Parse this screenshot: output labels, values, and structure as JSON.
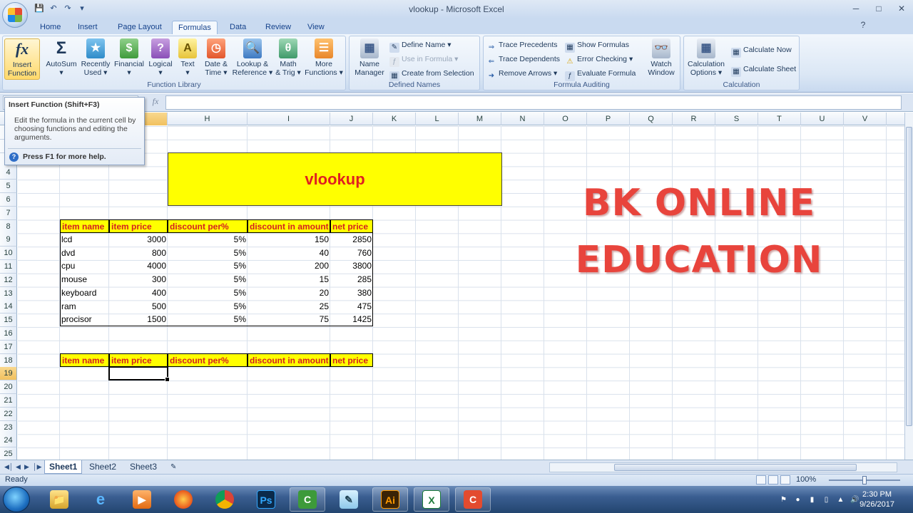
{
  "window": {
    "title": "vlookup - Microsoft Excel",
    "minimize_glyph": "─",
    "maximize_glyph": "□",
    "close_glyph": "✕"
  },
  "tabs": [
    "Home",
    "Insert",
    "Page Layout",
    "Formulas",
    "Data",
    "Review",
    "View"
  ],
  "ribbon": {
    "function_library": {
      "label": "Function Library",
      "buttons": [
        {
          "line1": "Insert",
          "line2": "Function",
          "icon": "fx-icon"
        },
        {
          "line1": "AutoSum",
          "line2": "▾",
          "icon": "sigma-icon"
        },
        {
          "line1": "Recently",
          "line2": "Used ▾",
          "icon": "book-icon"
        },
        {
          "line1": "Financial",
          "line2": "▾",
          "icon": "book-icon"
        },
        {
          "line1": "Logical",
          "line2": "▾",
          "icon": "book-icon"
        },
        {
          "line1": "Text",
          "line2": "▾",
          "icon": "book-icon"
        },
        {
          "line1": "Date &",
          "line2": "Time ▾",
          "icon": "book-icon"
        },
        {
          "line1": "Lookup &",
          "line2": "Reference ▾",
          "icon": "book-icon"
        },
        {
          "line1": "Math",
          "line2": "& Trig ▾",
          "icon": "book-icon"
        },
        {
          "line1": "More",
          "line2": "Functions ▾",
          "icon": "books-icon"
        }
      ]
    },
    "defined_names": {
      "label": "Defined Names",
      "name_manager_1": "Name",
      "name_manager_2": "Manager",
      "define_name": "Define Name ▾",
      "use_in_formula": "Use in Formula ▾",
      "create_from_selection": "Create from Selection"
    },
    "formula_auditing": {
      "label": "Formula Auditing",
      "trace_precedents": "Trace Precedents",
      "trace_dependents": "Trace Dependents",
      "remove_arrows": "Remove Arrows ▾",
      "show_formulas": "Show Formulas",
      "error_checking": "Error Checking ▾",
      "evaluate_formula": "Evaluate Formula",
      "watch_window_1": "Watch",
      "watch_window_2": "Window"
    },
    "calculation": {
      "label": "Calculation",
      "options_1": "Calculation",
      "options_2": "Options ▾",
      "calculate_now": "Calculate Now",
      "calculate_sheet": "Calculate Sheet"
    }
  },
  "formula_bar": {
    "fx": "fx",
    "name_box": "",
    "content": ""
  },
  "tooltip": {
    "title": "Insert Function (Shift+F3)",
    "body": "Edit the formula in the current cell by choosing functions and editing the arguments.",
    "help": "Press F1 for more help."
  },
  "columns": [
    "H",
    "I",
    "J",
    "K",
    "L",
    "M",
    "N",
    "O",
    "P",
    "Q",
    "R",
    "S",
    "T",
    "U",
    "V"
  ],
  "rows": [
    "4",
    "5",
    "6",
    "7",
    "8",
    "9",
    "10",
    "11",
    "12",
    "13",
    "14",
    "15",
    "16",
    "17",
    "18",
    "19",
    "20",
    "21",
    "22",
    "23",
    "24",
    "25"
  ],
  "sheet": {
    "banner": "vlookup",
    "brand_line1": "BK ONLINE",
    "brand_line2": "EDUCATION",
    "headers": [
      "item name",
      "item price",
      "discount per%",
      "discount in amount",
      "net price"
    ],
    "table": [
      [
        "lcd",
        "3000",
        "5%",
        "150",
        "2850"
      ],
      [
        "dvd",
        "800",
        "5%",
        "40",
        "760"
      ],
      [
        "cpu",
        "4000",
        "5%",
        "200",
        "3800"
      ],
      [
        "mouse",
        "300",
        "5%",
        "15",
        "285"
      ],
      [
        "keyboard",
        "400",
        "5%",
        "20",
        "380"
      ],
      [
        "ram",
        "500",
        "5%",
        "25",
        "475"
      ],
      [
        "procisor",
        "1500",
        "5%",
        "75",
        "1425"
      ]
    ],
    "lookup_headers": [
      "item name",
      "item price",
      "discount per%",
      "discount in amount",
      "net price"
    ]
  },
  "sheet_tabs": [
    "Sheet1",
    "Sheet2",
    "Sheet3"
  ],
  "status": {
    "text": "Ready",
    "zoom": "100%"
  },
  "clock": {
    "time": "2:30 PM",
    "date": "9/26/2017"
  },
  "taskbar_apps": [
    "explorer-icon",
    "internet-explorer-icon",
    "media-player-icon",
    "firefox-icon",
    "chrome-icon",
    "photoshop-icon",
    "camtasia-icon",
    "notepad-icon",
    "illustrator-icon",
    "excel-icon",
    "camtasia-recorder-icon"
  ]
}
